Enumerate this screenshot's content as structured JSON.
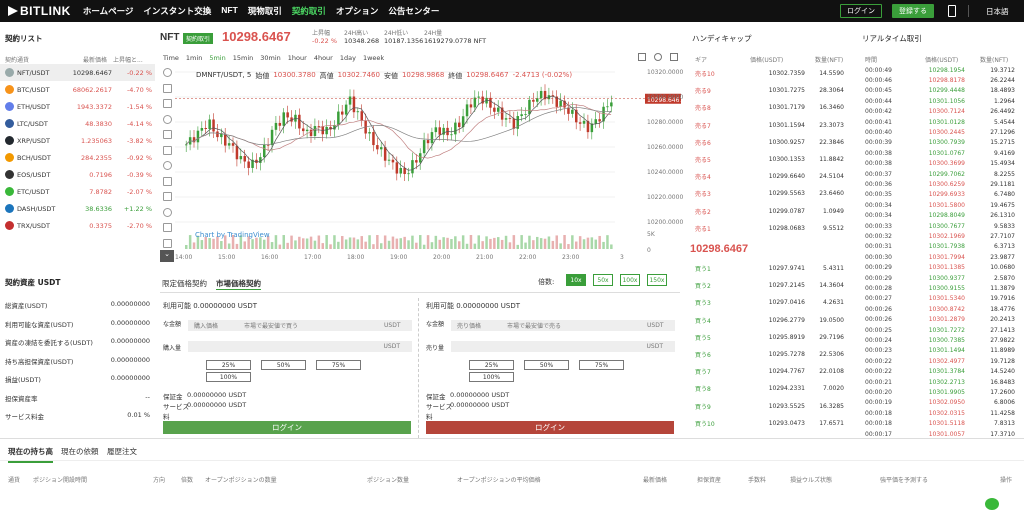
{
  "header": {
    "logo": "BITLINK",
    "nav": [
      "ホームページ",
      "インスタント交換",
      "NFT",
      "現物取引",
      "契約取引",
      "オプション",
      "公告センター"
    ],
    "active_nav": 4,
    "login": "ログイン",
    "register": "登録する",
    "lang": "日本語"
  },
  "contract_list": {
    "title": "契約リスト",
    "col_name": "契約通貨",
    "col_price": "最新価格",
    "col_change": "上昇幅と...",
    "rows": [
      {
        "name": "NFT/USDT",
        "price": "10298.6467",
        "change": "-0.22 %",
        "color": "#9aa"
      },
      {
        "name": "BTC/USDT",
        "price": "68062.2617",
        "change": "-4.70 %",
        "color": "#f7931a"
      },
      {
        "name": "ETH/USDT",
        "price": "1943.3372",
        "change": "-1.54 %",
        "color": "#627eea"
      },
      {
        "name": "LTC/USDT",
        "price": "48.3830",
        "change": "-4.14 %",
        "color": "#345d9d"
      },
      {
        "name": "XRP/USDT",
        "price": "1.235063",
        "change": "-3.82 %",
        "color": "#23292f"
      },
      {
        "name": "BCH/USDT",
        "price": "284.2355",
        "change": "-0.92 %",
        "color": "#f29900"
      },
      {
        "name": "EOS/USDT",
        "price": "0.7196",
        "change": "-0.39 %",
        "color": "#333"
      },
      {
        "name": "ETC/USDT",
        "price": "7.8782",
        "change": "-2.07 %",
        "color": "#3ab83a"
      },
      {
        "name": "DASH/USDT",
        "price": "38.6336",
        "change": "+1.22 %",
        "color": "#1c75bc"
      },
      {
        "name": "TRX/USDT",
        "price": "0.3375",
        "change": "-2.70 %",
        "color": "#c43030"
      }
    ]
  },
  "assets": {
    "title": "契約資産 USDT",
    "rows": [
      {
        "label": "総資産(USDT)",
        "value": "0.00000000"
      },
      {
        "label": "利用可能な資産(USDT)",
        "value": "0.00000000"
      },
      {
        "label": "資産の凍結を委託する(USDT)",
        "value": "0.00000000"
      },
      {
        "label": "持ち高担保資産(USDT)",
        "value": "0.00000000"
      },
      {
        "label": "損益(USDT)",
        "value": "0.00000000"
      },
      {
        "label": "担保資産率",
        "value": "--"
      },
      {
        "label": "サービス料金",
        "value": "0.01 %"
      }
    ]
  },
  "ticker": {
    "symbol": "NFT",
    "badge": "契約取引",
    "price": "10298.6467",
    "change_label": "上昇幅",
    "change": "-0.22 %",
    "high_label": "24H高い",
    "high": "10348.268",
    "low_label": "24H低い",
    "low": "10187.1356",
    "vol_label": "24H量",
    "vol": "1619279.0778 NFT"
  },
  "chart": {
    "timeframes": [
      "Time",
      "1min",
      "5min",
      "15min",
      "30min",
      "1hour",
      "4hour",
      "1day",
      "1week"
    ],
    "active_tf": 2,
    "legend": "DMNFT/USDT, 5",
    "open_l": "始値",
    "open": "10300.3780",
    "high_l": "高値",
    "high": "10302.7460",
    "low_l": "安値",
    "low": "10298.9868",
    "close_l": "終値",
    "close": "10298.6467",
    "chg": "-2.4713 (-0.02%)",
    "y_ticks": [
      "10320.0000",
      "10300.0000",
      "10280.0000",
      "10260.0000",
      "10240.0000",
      "10220.0000",
      "10200.0000",
      "5K",
      "0"
    ],
    "x_ticks": [
      "14:00",
      "15:00",
      "16:00",
      "17:00",
      "18:00",
      "19:00",
      "20:00",
      "21:00",
      "22:00",
      "23:00",
      "3"
    ],
    "price_tag": "10298.6467",
    "watermark": "Chart by TradingView"
  },
  "order_form": {
    "tab1": "限定価格契約",
    "tab2": "市場価格契約",
    "leverage_label": "倍数:",
    "leverages": [
      "10x",
      "50x",
      "100x",
      "150x"
    ],
    "buy": {
      "avail": "利用可能 0.00000000 USDT",
      "amount_label": "な金額",
      "price_label": "購入価格",
      "price_ph": "市場で最安値で買う",
      "unit": "USDT",
      "qty_label": "購入量",
      "margin": "保証金",
      "margin_v": "0.00000000 USDT",
      "fee": "サービス",
      "fee_v": "0.00000000 USDT",
      "fee2": "料",
      "btn": "ログイン"
    },
    "sell": {
      "avail": "利用可能 0.00000000 USDT",
      "amount_label": "な金額",
      "price_label": "売り価格",
      "price_ph": "市場で最安値で売る",
      "unit": "USDT",
      "qty_label": "売り量",
      "margin": "保証金",
      "margin_v": "0.00000000 USDT",
      "fee": "サービス",
      "fee_v": "0.00000000 USDT",
      "fee2": "料",
      "btn": "ログイン"
    },
    "pcts": [
      "25%",
      "50%",
      "75%",
      "100%"
    ]
  },
  "orderbook": {
    "title": "ハンディキャップ",
    "col1": "ギア",
    "col2": "価格(USDT)",
    "col3": "数量(NFT)",
    "mid": "10298.6467",
    "asks": [
      [
        "売る10",
        "10302.7359",
        "14.5590",
        0.95
      ],
      [
        "売る9",
        "10301.7275",
        "28.3064",
        0.9
      ],
      [
        "売る8",
        "10301.7179",
        "16.3460",
        0.6
      ],
      [
        "売る7",
        "10301.1594",
        "23.3073",
        0.8
      ],
      [
        "売る6",
        "10300.9257",
        "22.3846",
        0.78
      ],
      [
        "売る5",
        "10300.1353",
        "11.8842",
        0.5
      ],
      [
        "売る4",
        "10299.6640",
        "24.5104",
        0.85
      ],
      [
        "売る3",
        "10299.5563",
        "23.6460",
        0.82
      ],
      [
        "売る2",
        "10299.0787",
        "1.0949",
        0.1
      ],
      [
        "売る1",
        "10298.0683",
        "9.5512",
        0.35
      ]
    ],
    "bids": [
      [
        "買う1",
        "10297.9741",
        "5.4311",
        0.25
      ],
      [
        "買う2",
        "10297.2145",
        "14.3604",
        0.55
      ],
      [
        "買う3",
        "10297.0416",
        "4.2631",
        0.2
      ],
      [
        "買う4",
        "10296.2779",
        "19.0500",
        0.7
      ],
      [
        "買う5",
        "10295.8919",
        "29.7196",
        0.95
      ],
      [
        "買う6",
        "10295.7278",
        "22.5306",
        0.8
      ],
      [
        "買う7",
        "10294.7767",
        "22.0108",
        0.78
      ],
      [
        "買う8",
        "10294.2331",
        "7.0020",
        0.3
      ],
      [
        "買う9",
        "10293.5525",
        "16.3285",
        0.6
      ],
      [
        "買う10",
        "10293.0473",
        "17.6571",
        0.62
      ]
    ]
  },
  "trades": {
    "title": "リアルタイム取引",
    "col1": "時間",
    "col2": "価格(USDT)",
    "col3": "数量(NFT)",
    "rows": [
      [
        "00:00:49",
        "10298.1954",
        "19.3712",
        "g"
      ],
      [
        "00:00:46",
        "10298.8178",
        "26.2244",
        "r"
      ],
      [
        "00:00:45",
        "10299.4448",
        "18.4893",
        "g"
      ],
      [
        "00:00:44",
        "10301.1056",
        "1.2964",
        "g"
      ],
      [
        "00:00:42",
        "10300.7124",
        "26.4492",
        "r"
      ],
      [
        "00:00:41",
        "10301.0128",
        "5.4544",
        "g"
      ],
      [
        "00:00:40",
        "10300.2445",
        "27.1296",
        "r"
      ],
      [
        "00:00:39",
        "10300.7939",
        "15.2715",
        "g"
      ],
      [
        "00:00:38",
        "10301.0767",
        "9.4169",
        "g"
      ],
      [
        "00:00:38",
        "10300.3699",
        "15.4934",
        "r"
      ],
      [
        "00:00:37",
        "10299.7062",
        "8.2255",
        "g"
      ],
      [
        "00:00:36",
        "10300.6259",
        "29.1181",
        "r"
      ],
      [
        "00:00:35",
        "10299.6933",
        "6.7480",
        "r"
      ],
      [
        "00:00:34",
        "10301.5800",
        "19.4675",
        "r"
      ],
      [
        "00:00:34",
        "10298.8049",
        "26.1310",
        "g"
      ],
      [
        "00:00:33",
        "10300.7677",
        "9.5833",
        "g"
      ],
      [
        "00:00:32",
        "10302.1969",
        "27.7107",
        "r"
      ],
      [
        "00:00:31",
        "10301.7938",
        "6.3713",
        "g"
      ],
      [
        "00:00:30",
        "10301.7994",
        "23.9877",
        "r"
      ],
      [
        "00:00:29",
        "10301.1385",
        "10.0680",
        "r"
      ],
      [
        "00:00:29",
        "10300.9377",
        "2.5870",
        "g"
      ],
      [
        "00:00:28",
        "10300.9155",
        "11.3879",
        "g"
      ],
      [
        "00:00:27",
        "10301.5340",
        "19.7916",
        "r"
      ],
      [
        "00:00:26",
        "10300.8742",
        "18.4776",
        "r"
      ],
      [
        "00:00:26",
        "10301.2879",
        "20.2413",
        "r"
      ],
      [
        "00:00:25",
        "10301.7272",
        "27.1413",
        "g"
      ],
      [
        "00:00:24",
        "10300.7385",
        "27.9822",
        "g"
      ],
      [
        "00:00:23",
        "10301.1494",
        "11.8989",
        "g"
      ],
      [
        "00:00:22",
        "10302.4977",
        "19.7128",
        "r"
      ],
      [
        "00:00:22",
        "10301.3784",
        "14.5240",
        "g"
      ],
      [
        "00:00:21",
        "10302.2713",
        "16.8483",
        "g"
      ],
      [
        "00:00:20",
        "10301.9905",
        "17.2600",
        "g"
      ],
      [
        "00:00:19",
        "10302.0950",
        "6.8006",
        "r"
      ],
      [
        "00:00:18",
        "10302.0315",
        "11.4258",
        "r"
      ],
      [
        "00:00:18",
        "10301.5118",
        "7.8313",
        "r"
      ],
      [
        "00:00:17",
        "10301.0057",
        "17.3710",
        "r"
      ]
    ]
  },
  "positions": {
    "tabs": [
      "現在の持ち高",
      "現在の依頼",
      "履歴注文"
    ],
    "cols": [
      "通貨",
      "ポジション開設時間",
      "方向",
      "倍数",
      "オープンポジションの数量",
      "ポジション数量",
      "オープンポジションの平均価格",
      "最新価格",
      "担保資産",
      "手数料",
      "損益ウルズ状態",
      "強平価を予測する",
      "操作"
    ]
  }
}
